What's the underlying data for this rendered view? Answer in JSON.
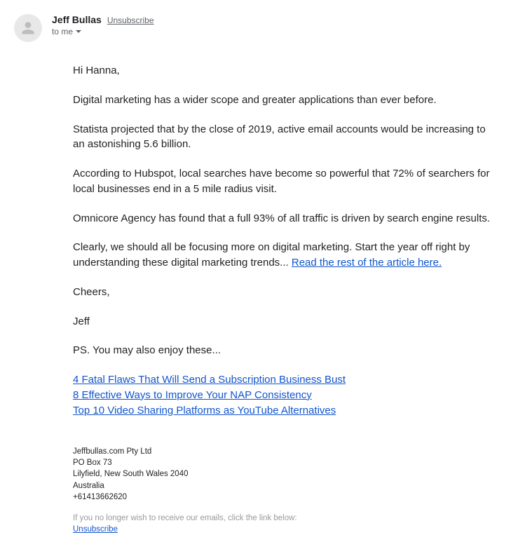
{
  "header": {
    "sender_name": "Jeff Bullas",
    "unsubscribe_label": "Unsubscribe",
    "recipient_label": "to me"
  },
  "body": {
    "greeting": "Hi Hanna,",
    "p1": "Digital marketing has a wider scope and greater applications than ever before.",
    "p2": "Statista projected that by the close of 2019, active email accounts would be increasing to an astonishing 5.6 billion.",
    "p3": "According to Hubspot, local searches have become so powerful that 72% of searchers for local businesses end in a 5 mile radius visit.",
    "p4": "Omnicore Agency has found that a full 93% of all traffic is driven by search engine results.",
    "p5_prefix": "Clearly, we should all be focusing more on digital marketing. Start the year off right by understanding these digital marketing trends... ",
    "p5_link": "Read the rest of the article here.",
    "signoff": "Cheers,",
    "signature": "Jeff",
    "ps_intro": "PS. You may also enjoy these...",
    "ps_links": [
      "4 Fatal Flaws That Will Send a Subscription Business Bust",
      "8 Effective Ways to Improve Your NAP Consistency",
      "Top 10 Video Sharing Platforms as YouTube Alternatives"
    ]
  },
  "footer": {
    "company": "Jeffbullas.com Pty Ltd",
    "po_box": "PO Box 73",
    "city": "Lilyfield, New South Wales 2040",
    "country": "Australia",
    "phone": "+61413662620",
    "note": "If you no longer wish to receive our emails, click the link below:",
    "unsubscribe": "Unsubscribe"
  }
}
